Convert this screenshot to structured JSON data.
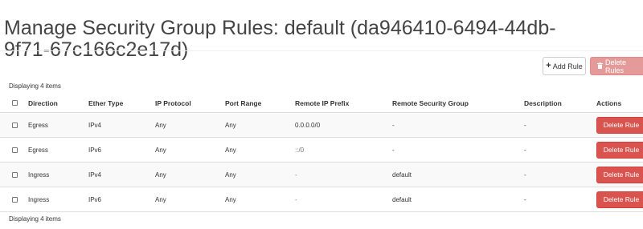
{
  "page": {
    "title": "Manage Security Group Rules: default (da946410-6494-44db-9f71-67c166c2e17d)"
  },
  "toolbar": {
    "add_rule_label": "Add Rule",
    "add_rule_icon": "plus-icon",
    "delete_rules_label": "Delete Rules",
    "delete_rules_icon": "trash-icon"
  },
  "table": {
    "summary_top": "Displaying 4 items",
    "summary_bottom": "Displaying 4 items",
    "columns": {
      "direction": "Direction",
      "ether_type": "Ether Type",
      "ip_protocol": "IP Protocol",
      "port_range": "Port Range",
      "remote_ip_prefix": "Remote IP Prefix",
      "remote_security_group": "Remote Security Group",
      "description": "Description",
      "actions": "Actions"
    },
    "rows": [
      {
        "direction": "Egress",
        "ether_type": "IPv4",
        "ip_protocol": "Any",
        "port_range": "Any",
        "remote_ip_prefix": "0.0.0.0/0",
        "remote_security_group": "-",
        "description": "-",
        "action_label": "Delete Rule"
      },
      {
        "direction": "Egress",
        "ether_type": "IPv6",
        "ip_protocol": "Any",
        "port_range": "Any",
        "remote_ip_prefix": "::/0",
        "remote_security_group": "-",
        "description": "-",
        "action_label": "Delete Rule"
      },
      {
        "direction": "Ingress",
        "ether_type": "IPv4",
        "ip_protocol": "Any",
        "port_range": "Any",
        "remote_ip_prefix": "-",
        "remote_security_group": "default",
        "description": "-",
        "action_label": "Delete Rule"
      },
      {
        "direction": "Ingress",
        "ether_type": "IPv6",
        "ip_protocol": "Any",
        "port_range": "Any",
        "remote_ip_prefix": "-",
        "remote_security_group": "default",
        "description": "-",
        "action_label": "Delete Rule"
      }
    ]
  },
  "colors": {
    "danger": "#d9534f",
    "danger_disabled": "#e49a98"
  }
}
